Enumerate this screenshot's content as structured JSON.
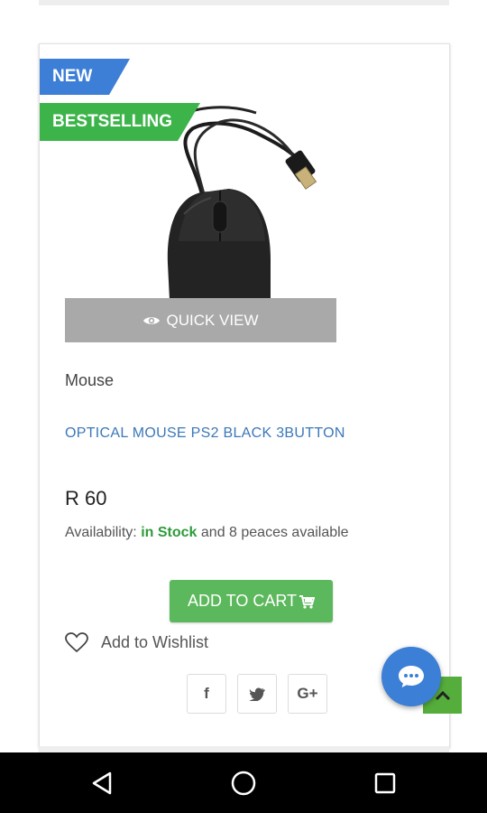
{
  "badges": {
    "new": "NEW",
    "bestselling": "BESTSELLING"
  },
  "product": {
    "image_icon": "usb-mouse-image",
    "quick_view": "QUICK VIEW",
    "category": "Mouse",
    "title": "OPTICAL MOUSE PS2 BLACK 3BUTTON",
    "price": "R 60",
    "availability": {
      "label": "Availability:",
      "status": "in Stock",
      "rest": "and 8 peaces available"
    },
    "add_to_cart": "ADD TO CART",
    "wishlist": "Add to Wishlist"
  },
  "share": [
    {
      "icon": "facebook-icon",
      "glyph": "f"
    },
    {
      "icon": "twitter-icon",
      "glyph": "t"
    },
    {
      "icon": "google-plus-icon",
      "glyph": "G+"
    }
  ],
  "colors": {
    "badge_new": "#3d7fd6",
    "badge_bestselling": "#3cb44a",
    "title_link": "#3b78b8",
    "in_stock": "#2e9b3a",
    "add_to_cart": "#5cb85c",
    "chat": "#3b7fd6",
    "scroll_top": "#55ad3b"
  },
  "floating": {
    "chat_icon": "chat-bubble-icon",
    "scroll_top_icon": "chevron-up-icon"
  },
  "system_nav": [
    "back-icon",
    "home-icon",
    "recents-icon"
  ]
}
